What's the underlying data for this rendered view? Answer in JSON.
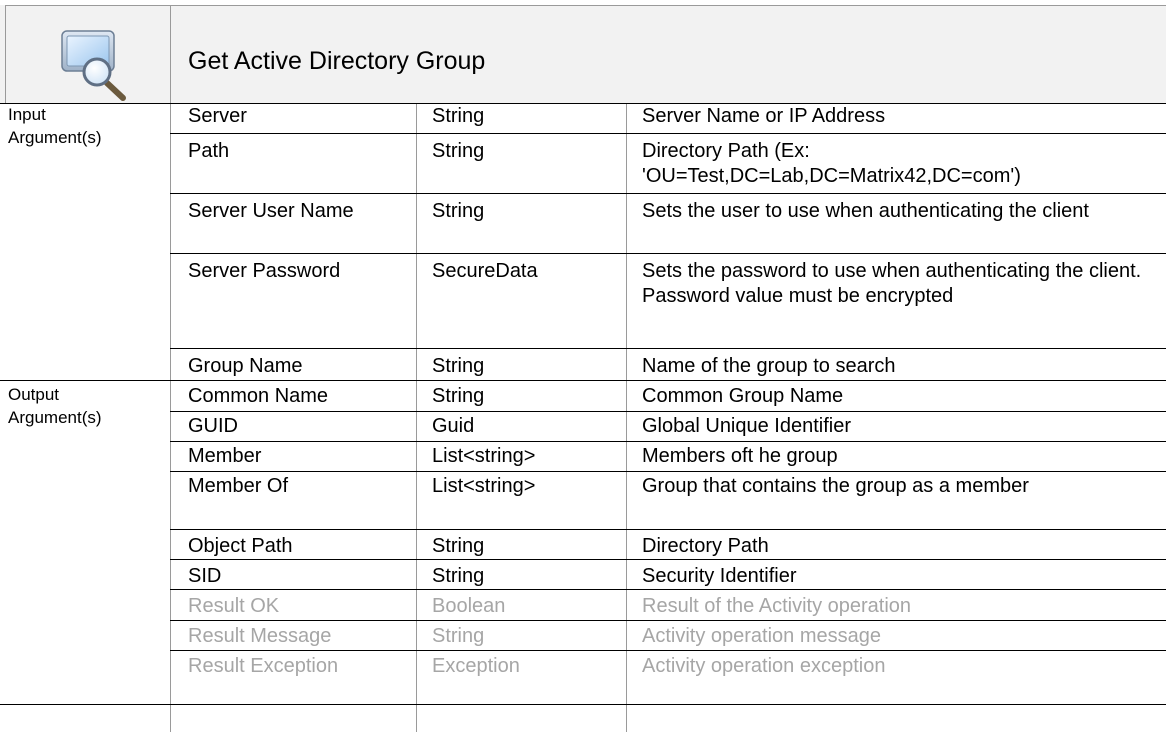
{
  "header": {
    "icon": "search-window-icon",
    "title": "Get Active Directory Group"
  },
  "input_section": {
    "label": "Input\nArgument(s)",
    "rows": [
      {
        "name": "Server",
        "type": "String",
        "desc": "Server Name or IP Address"
      },
      {
        "name": "Path",
        "type": "String",
        "desc": "Directory Path (Ex: 'OU=Test,DC=Lab,DC=Matrix42,DC=com')"
      },
      {
        "name": "Server User Name",
        "type": "String",
        "desc": "Sets the user to use when authenticating the client"
      },
      {
        "name": "Server Password",
        "type": "SecureData",
        "desc": "Sets the password to use when authenticating the client. Password value must be encrypted"
      },
      {
        "name": "Group Name",
        "type": "String",
        "desc": "Name of the group to search"
      }
    ]
  },
  "output_section": {
    "label": "Output\nArgument(s)",
    "rows": [
      {
        "name": "Common Name",
        "type": "String",
        "desc": "Common Group Name"
      },
      {
        "name": "GUID",
        "type": "Guid",
        "desc": "Global Unique Identifier"
      },
      {
        "name": "Member",
        "type": "List<string>",
        "desc": "Members oft he group"
      },
      {
        "name": "Member Of",
        "type": "List<string>",
        "desc": "Group that contains the group as a member"
      },
      {
        "name": "Object Path",
        "type": "String",
        "desc": "Directory Path"
      },
      {
        "name": "SID",
        "type": "String",
        "desc": "Security Identifier"
      },
      {
        "name": "Result OK",
        "type": "Boolean",
        "desc": "Result of the Activity operation"
      },
      {
        "name": "Result Message",
        "type": "String",
        "desc": "Activity operation message"
      },
      {
        "name": "Result Exception",
        "type": "Exception",
        "desc": "Activity operation exception"
      }
    ]
  },
  "colors": {
    "header_bg": "#f2f2f2",
    "dimmed_text": "#a6a6a6",
    "grid_line": "#9a9a9a"
  }
}
